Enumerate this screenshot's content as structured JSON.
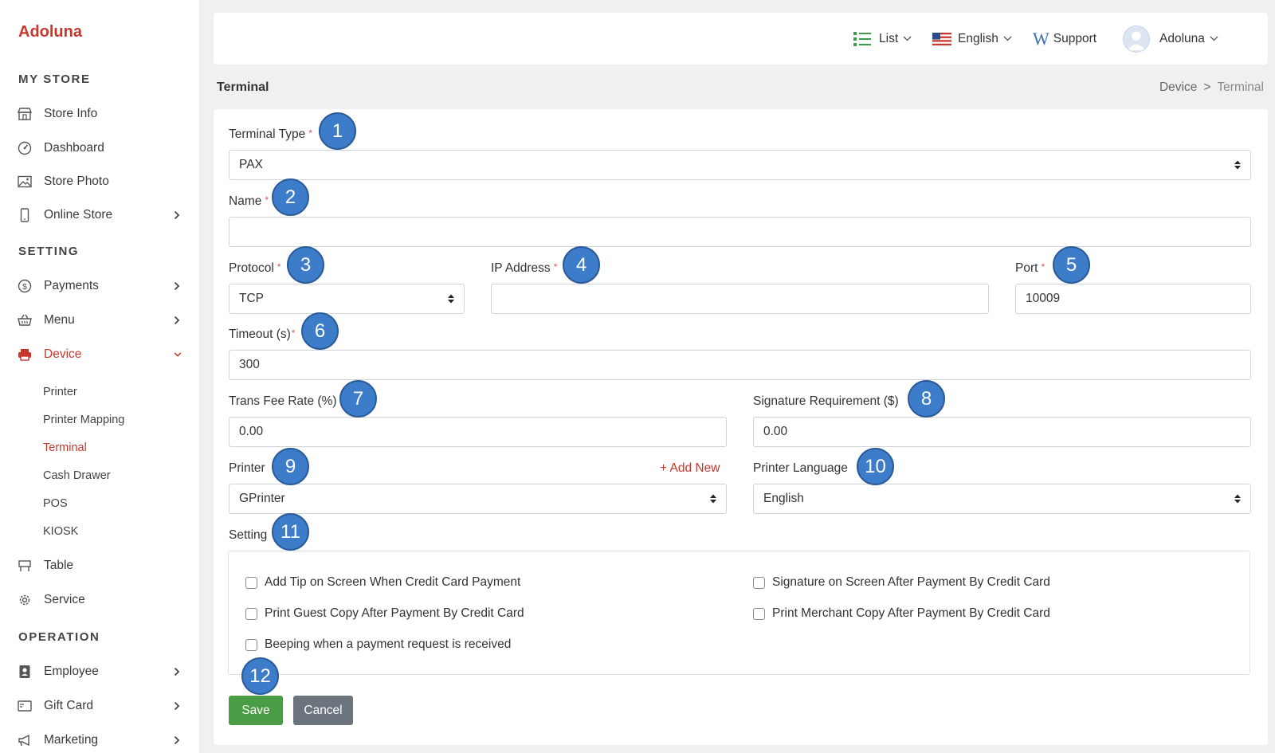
{
  "app": {
    "logo": "Adoluna"
  },
  "sidebar": {
    "sections": [
      {
        "title": "MY STORE"
      },
      {
        "title": "SETTING"
      },
      {
        "title": "OPERATION"
      }
    ],
    "items": [
      {
        "label": "Store Info",
        "icon": "store-icon"
      },
      {
        "label": "Dashboard",
        "icon": "dashboard-icon"
      },
      {
        "label": "Store Photo",
        "icon": "photo-icon"
      },
      {
        "label": "Online Store",
        "icon": "mobile-icon"
      },
      {
        "label": "Payments",
        "icon": "dollar-icon"
      },
      {
        "label": "Menu",
        "icon": "basket-icon"
      },
      {
        "label": "Device",
        "icon": "printer-icon"
      },
      {
        "label": "Table",
        "icon": "table-icon"
      },
      {
        "label": "Service",
        "icon": "gear-icon"
      },
      {
        "label": "Employee",
        "icon": "badge-icon"
      },
      {
        "label": "Gift Card",
        "icon": "gift-card-icon"
      },
      {
        "label": "Marketing",
        "icon": "megaphone-icon"
      }
    ],
    "device_sub": [
      "Printer",
      "Printer Mapping",
      "Terminal",
      "Cash Drawer",
      "POS",
      "KIOSK"
    ]
  },
  "topbar": {
    "list_label": "List",
    "language_label": "English",
    "support_label": "Support",
    "user_label": "Adoluna"
  },
  "page": {
    "title": "Terminal",
    "breadcrumb": [
      "Device",
      ">",
      "Terminal"
    ]
  },
  "form": {
    "terminal_type": {
      "label": "Terminal Type",
      "value": "PAX"
    },
    "name": {
      "label": "Name",
      "value": ""
    },
    "protocol": {
      "label": "Protocol",
      "value": "TCP"
    },
    "ip_address": {
      "label": "IP Address",
      "value": ""
    },
    "port": {
      "label": "Port",
      "value": "10009"
    },
    "timeout": {
      "label": "Timeout (s)",
      "value": "300"
    },
    "trans_fee": {
      "label": "Trans Fee Rate (%)",
      "value": "0.00"
    },
    "signature_req": {
      "label": "Signature Requirement ($)",
      "value": "0.00"
    },
    "printer": {
      "label": "Printer",
      "value": "GPrinter",
      "add_new": "+  Add New"
    },
    "printer_language": {
      "label": "Printer Language",
      "value": "English"
    },
    "setting": {
      "label": "Setting"
    },
    "checkboxes": [
      "Add Tip on Screen When Credit Card Payment",
      "Signature on Screen After Payment By Credit Card",
      "Print Guest Copy After Payment By Credit Card",
      "Print Merchant Copy After Payment By Credit Card",
      "Beeping when a payment request is received"
    ],
    "required_mark": "*",
    "save_label": "Save",
    "cancel_label": "Cancel"
  },
  "badges": [
    "1",
    "2",
    "3",
    "4",
    "5",
    "6",
    "7",
    "8",
    "9",
    "10",
    "11",
    "12"
  ],
  "colors": {
    "brand": "#c8372d",
    "save": "#4a9d45",
    "cancel": "#6c757d",
    "badge": "#3d7cc9"
  }
}
